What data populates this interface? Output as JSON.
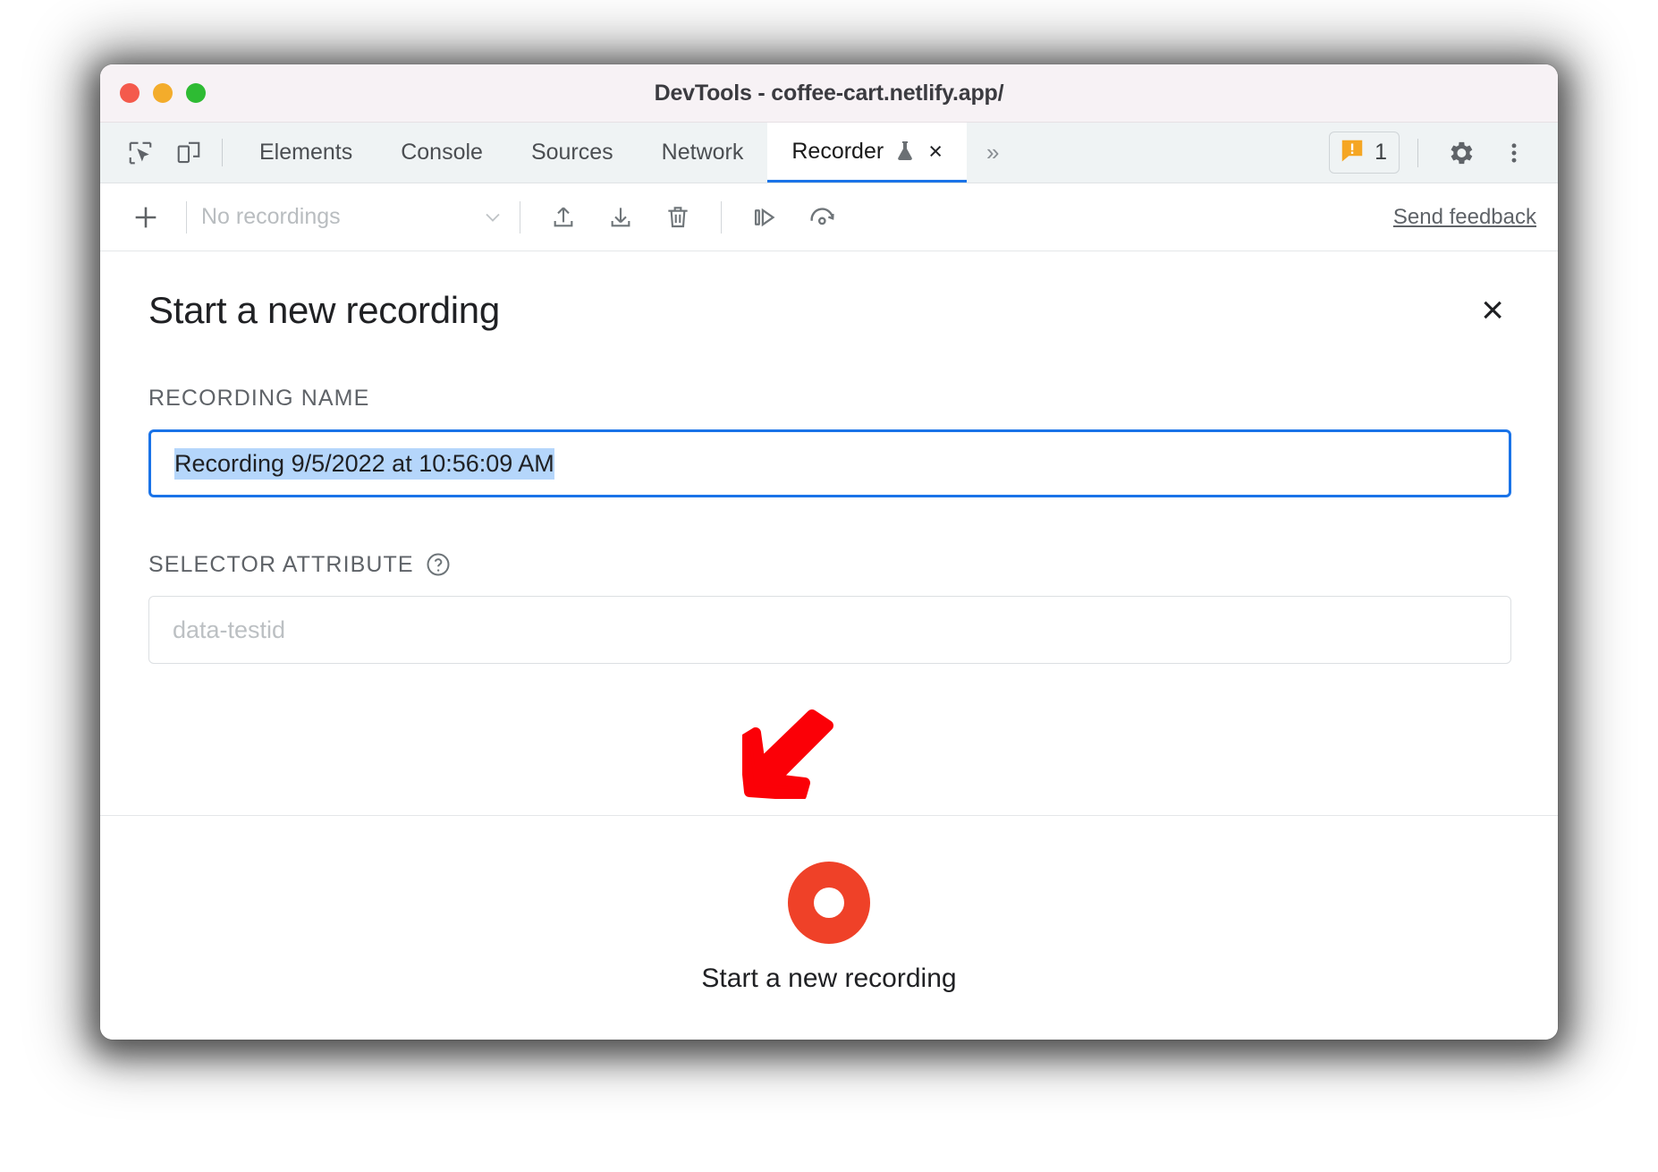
{
  "window": {
    "title": "DevTools - coffee-cart.netlify.app/",
    "traffic_lights": [
      "close",
      "minimize",
      "maximize"
    ],
    "colors": {
      "close": "#f45a4c",
      "minimize": "#f3ac2b",
      "maximize": "#2ebb33",
      "accent": "#1a73e8",
      "record": "#ef4128",
      "warning": "#f5a623",
      "selection": "#b5d6fb"
    }
  },
  "tabstrip": {
    "left_icons": [
      {
        "name": "inspect-element-icon"
      },
      {
        "name": "device-toolbar-icon"
      }
    ],
    "tabs": [
      {
        "label": "Elements",
        "active": false
      },
      {
        "label": "Console",
        "active": false
      },
      {
        "label": "Sources",
        "active": false
      },
      {
        "label": "Network",
        "active": false
      },
      {
        "label": "Recorder",
        "active": true,
        "experimental": true,
        "closable": true
      }
    ],
    "overflow_label": "»",
    "tab_close_label": "×",
    "warnings": {
      "count": "1",
      "icon": "warning-message-icon"
    },
    "settings_label": "gear-icon",
    "more_label": "kebab-menu-icon"
  },
  "recorder_toolbar": {
    "add_label": "+",
    "recordings_select": {
      "value": "No recordings",
      "chevron": "chevron-down-icon"
    },
    "tools": [
      {
        "name": "import-recording-icon"
      },
      {
        "name": "export-recording-icon"
      },
      {
        "name": "delete-recording-icon"
      },
      {
        "name": "step-replay-icon"
      },
      {
        "name": "replay-speed-icon"
      }
    ],
    "send_feedback_label": "Send feedback"
  },
  "panel": {
    "title": "Start a new recording",
    "close_label": "×",
    "recording_name": {
      "label": "Recording name",
      "value": "Recording 9/5/2022 at 10:56:09 AM",
      "selected": true,
      "focused": true
    },
    "selector_attribute": {
      "label": "Selector attribute",
      "help_icon": "help-circle-icon",
      "value": "",
      "placeholder": "data-testid"
    },
    "footer": {
      "record_button_label": "Start a new recording",
      "record_icon": "record-circle-icon"
    }
  },
  "annotation": {
    "arrow": {
      "name": "red-arrow-annotation",
      "color": "#fb0007",
      "points_to": "recording-name-input"
    }
  }
}
